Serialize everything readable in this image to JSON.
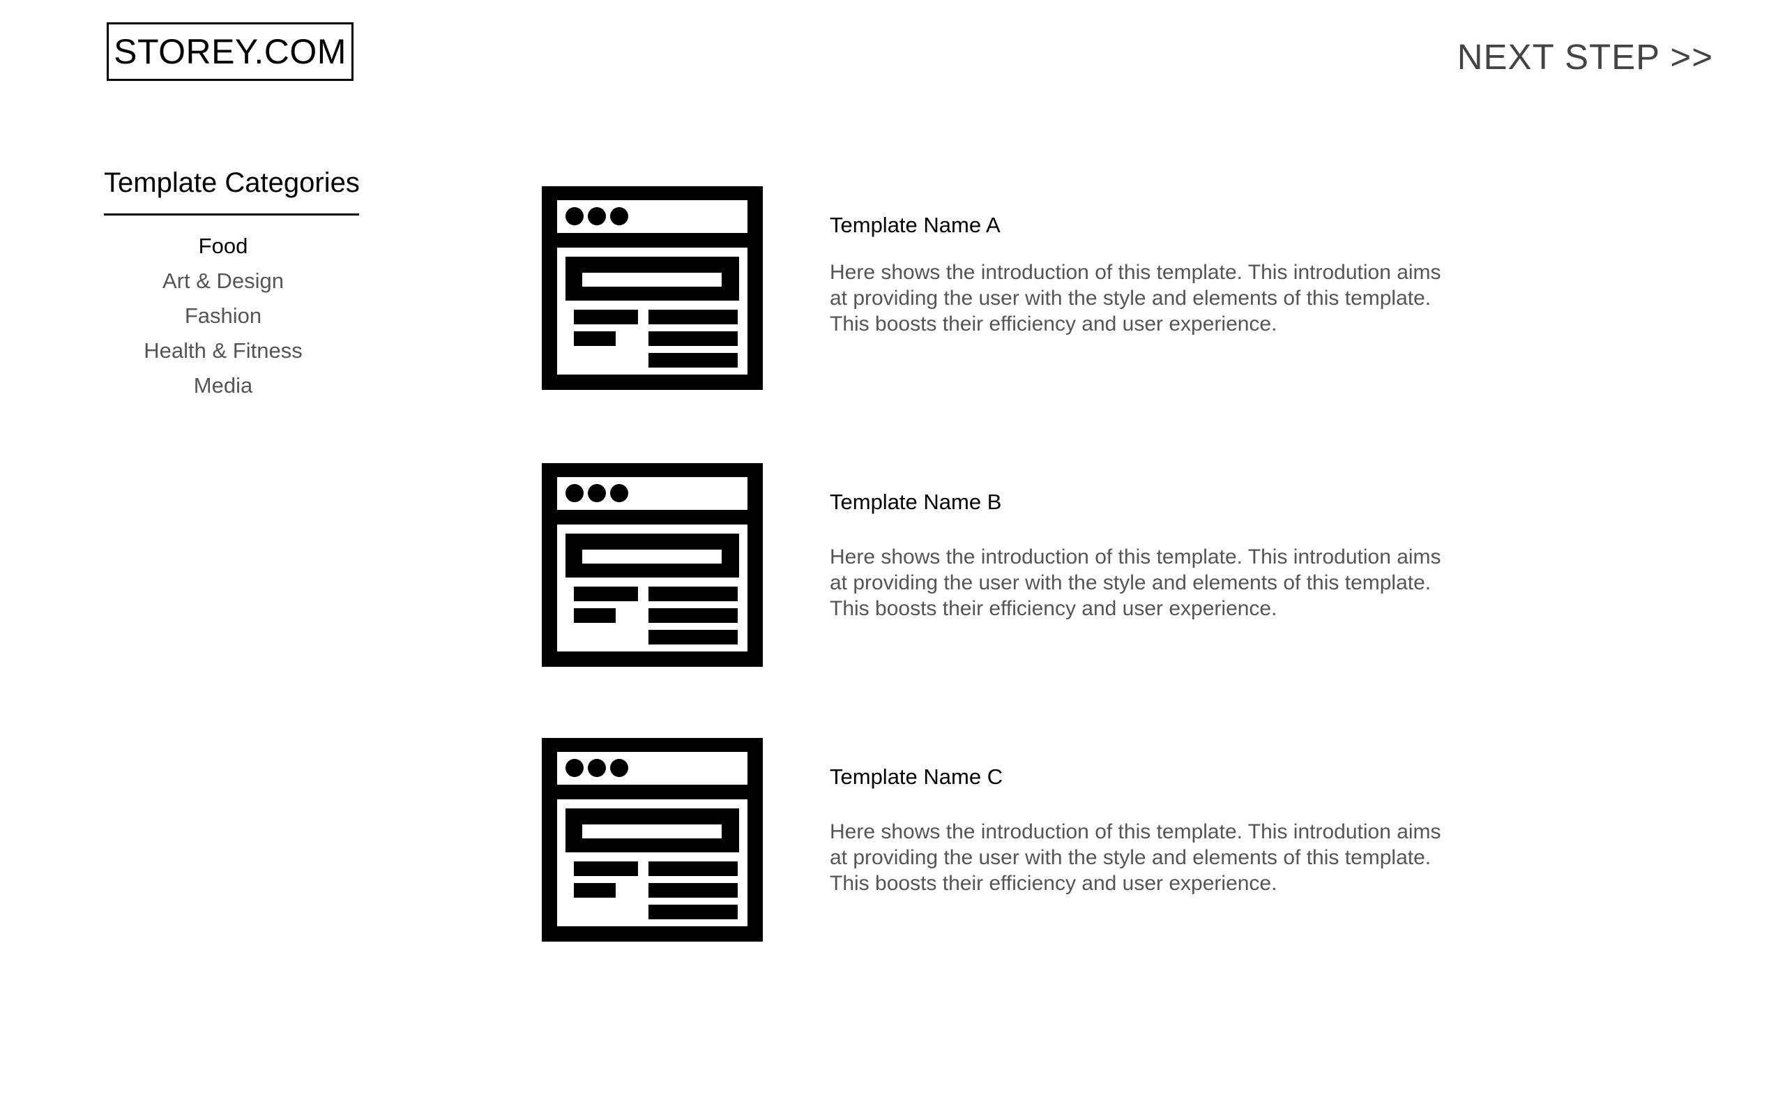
{
  "header": {
    "logo": "STOREY.COM",
    "next_step": "NEXT STEP >>"
  },
  "sidebar": {
    "title": "Template Categories",
    "items": [
      {
        "label": "Food",
        "active": true
      },
      {
        "label": "Art & Design",
        "active": false
      },
      {
        "label": "Fashion",
        "active": false
      },
      {
        "label": "Health & Fitness",
        "active": false
      },
      {
        "label": "Media",
        "active": false
      }
    ]
  },
  "templates": [
    {
      "name": "Template Name A",
      "description": "Here shows the introduction of this template. This introdution aims at providing the user with the style and elements of this template. This boosts their efficiency and user experience.",
      "icon": "browser-template-icon"
    },
    {
      "name": "Template Name B",
      "description": "Here shows the introduction of this template. This introdution aims at providing the user with the style and elements of this template. This boosts their efficiency and user experience.",
      "icon": "browser-template-icon"
    },
    {
      "name": "Template Name C",
      "description": "Here shows the introduction of this template. This introdution aims at providing the user with the style and elements of this template. This boosts their efficiency and user experience.",
      "icon": "browser-template-icon"
    }
  ]
}
